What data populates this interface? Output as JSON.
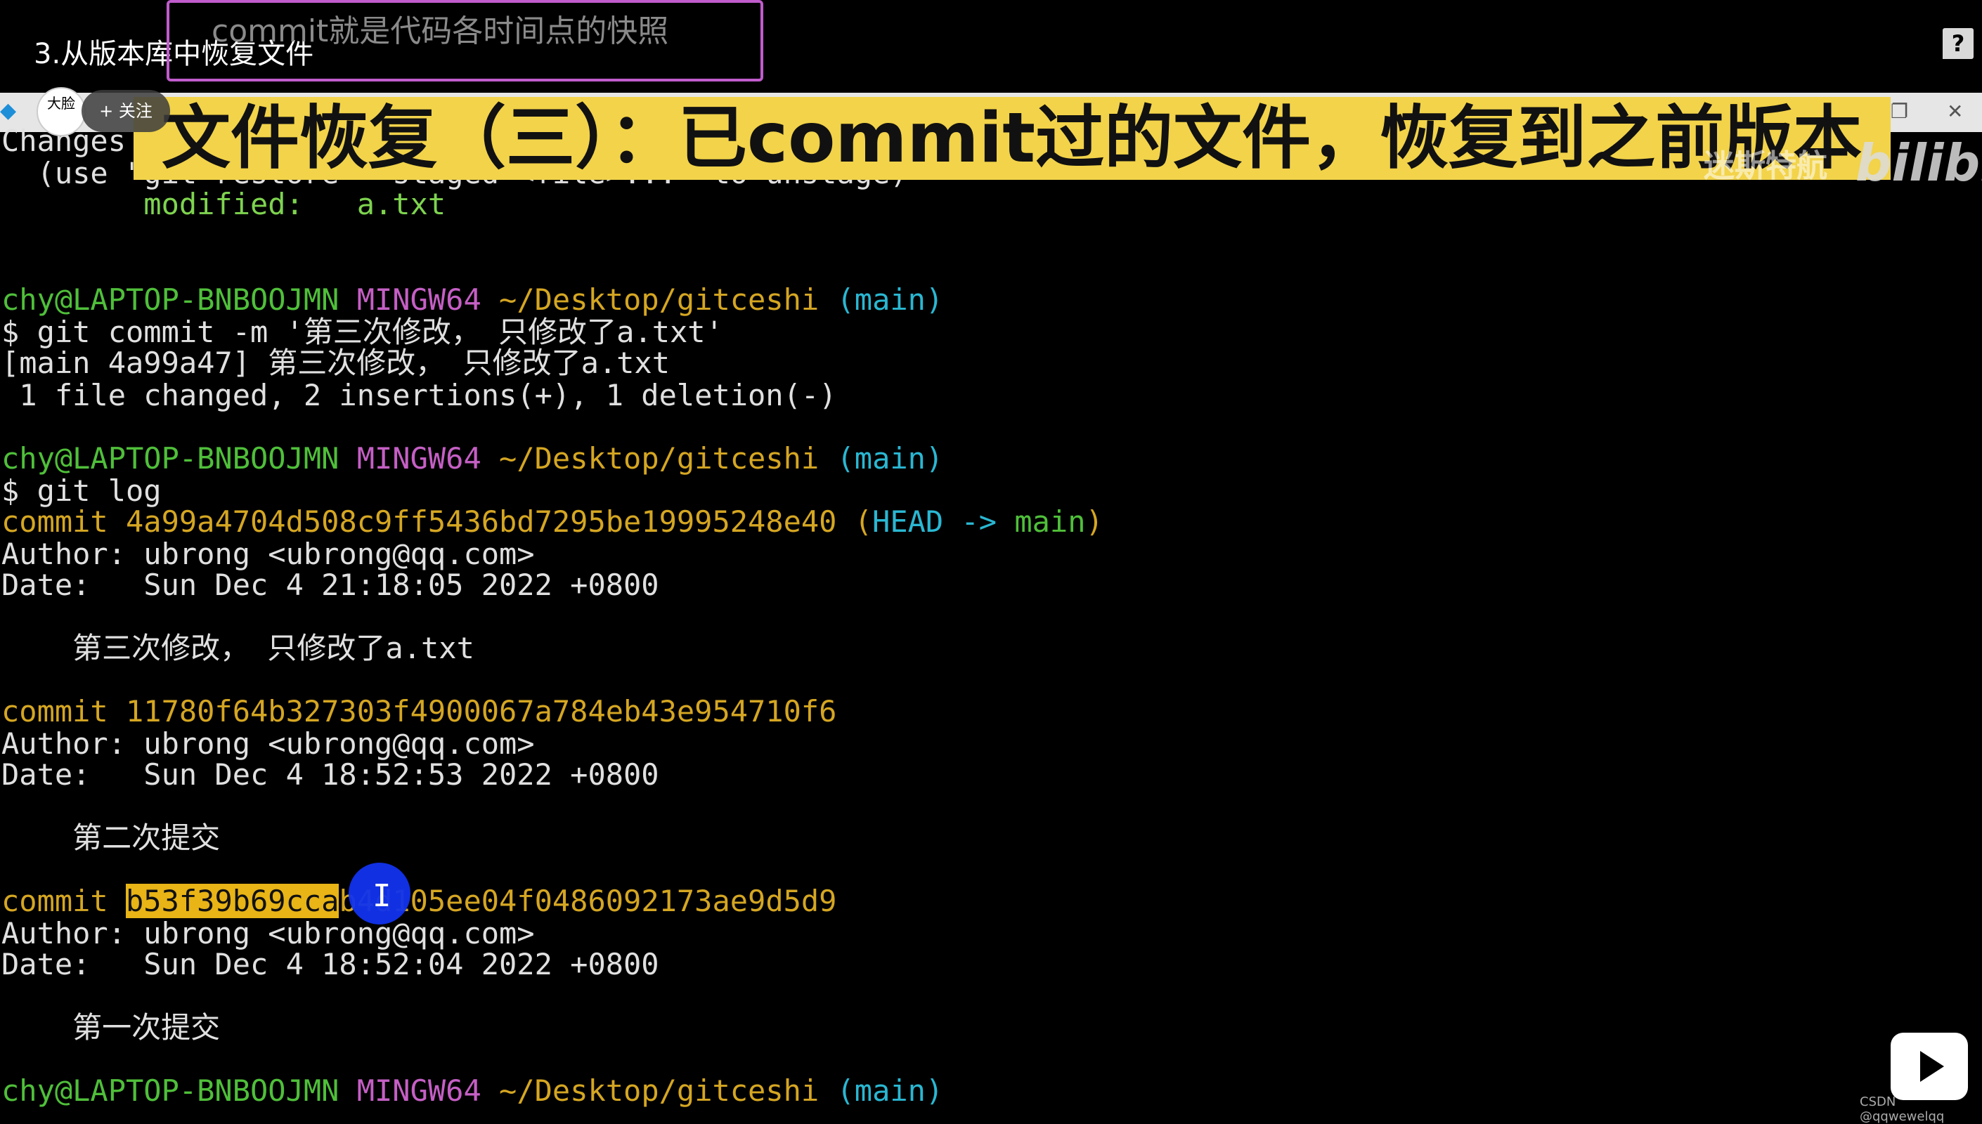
{
  "video": {
    "title": "3.从版本库中恢复文件",
    "caption": "commit就是代码各时间点的快照",
    "help_label": "?",
    "follow_label": "+ 关注",
    "avatar_text": "大脸",
    "banner": "文件恢复（三）：已commit过的文件，恢复到之前版本",
    "banner_watermark": "迷斯特航",
    "bili_logo": "bilibili",
    "credit": "CSDN @qqwewelqq"
  },
  "terminal": {
    "lines": {
      "l1": "Changes",
      "l2": "  (use \"git restore --staged <file>...\" to unstage)",
      "l3": "        modified:   a.txt",
      "p1_user": "chy@LAPTOP-BNBOOJMN",
      "p1_env": "MINGW64",
      "p1_path": "~/Desktop/gitceshi",
      "p1_branch": "(main)",
      "cmd1": "$ git commit -m '第三次修改， 只修改了a.txt'",
      "out1": "[main 4a99a47] 第三次修改， 只修改了a.txt",
      "out2": " 1 file changed, 2 insertions(+), 1 deletion(-)",
      "p2_user": "chy@LAPTOP-BNBOOJMN",
      "p2_env": "MINGW64",
      "p2_path": "~/Desktop/gitceshi",
      "p2_branch": "(main)",
      "cmd2": "$ git log",
      "c1_word": "commit ",
      "c1_hash": "4a99a4704d508c9ff5436bd7295be19995248e40",
      "c1_open": " (",
      "c1_head": "HEAD -> ",
      "c1_main": "main",
      "c1_close": ")",
      "c1_author": "Author: ubrong <ubrong@qq.com>",
      "c1_date": "Date:   Sun Dec 4 21:18:05 2022 +0800",
      "c1_msg": "    第三次修改， 只修改了a.txt",
      "c2": "commit 11780f64b327303f4900067a784eb43e954710f6",
      "c2_author": "Author: ubrong <ubrong@qq.com>",
      "c2_date": "Date:   Sun Dec 4 18:52:53 2022 +0800",
      "c2_msg": "    第二次提交",
      "c3_word": "commit ",
      "c3_hash_hl": "b53f39b69cca",
      "c3_hash_rest": "b4d105ee04f0486092173ae9d5d9",
      "c3_author": "Author: ubrong <ubrong@qq.com>",
      "c3_date": "Date:   Sun Dec 4 18:52:04 2022 +0800",
      "c3_msg": "    第一次提交",
      "p3_user": "chy@LAPTOP-BNBOOJMN",
      "p3_env": "MINGW64",
      "p3_path": "~/Desktop/gitceshi",
      "p3_branch": "(main)"
    }
  },
  "icons": {
    "help": "help-icon",
    "gitbash": "gitbash-icon",
    "restore": "restore-window-icon",
    "close": "close-window-icon",
    "cursor": "text-cursor-icon",
    "play": "bilibili-tv-icon"
  }
}
